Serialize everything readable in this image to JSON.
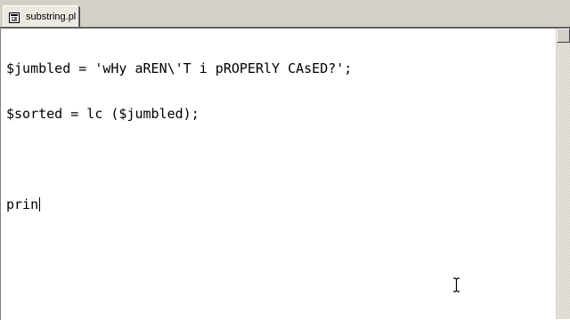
{
  "tab": {
    "filename": "substring.pl",
    "icon": "perl-file-icon"
  },
  "editor": {
    "lines": [
      "$jumbled = 'wHy aREN\\'T i pROPERlY CAsED?';",
      "$sorted = lc ($jumbled);",
      "",
      "prin"
    ]
  },
  "colors": {
    "chrome": "#d4d0c8",
    "editor_bg": "#ffffff",
    "text": "#000000"
  }
}
